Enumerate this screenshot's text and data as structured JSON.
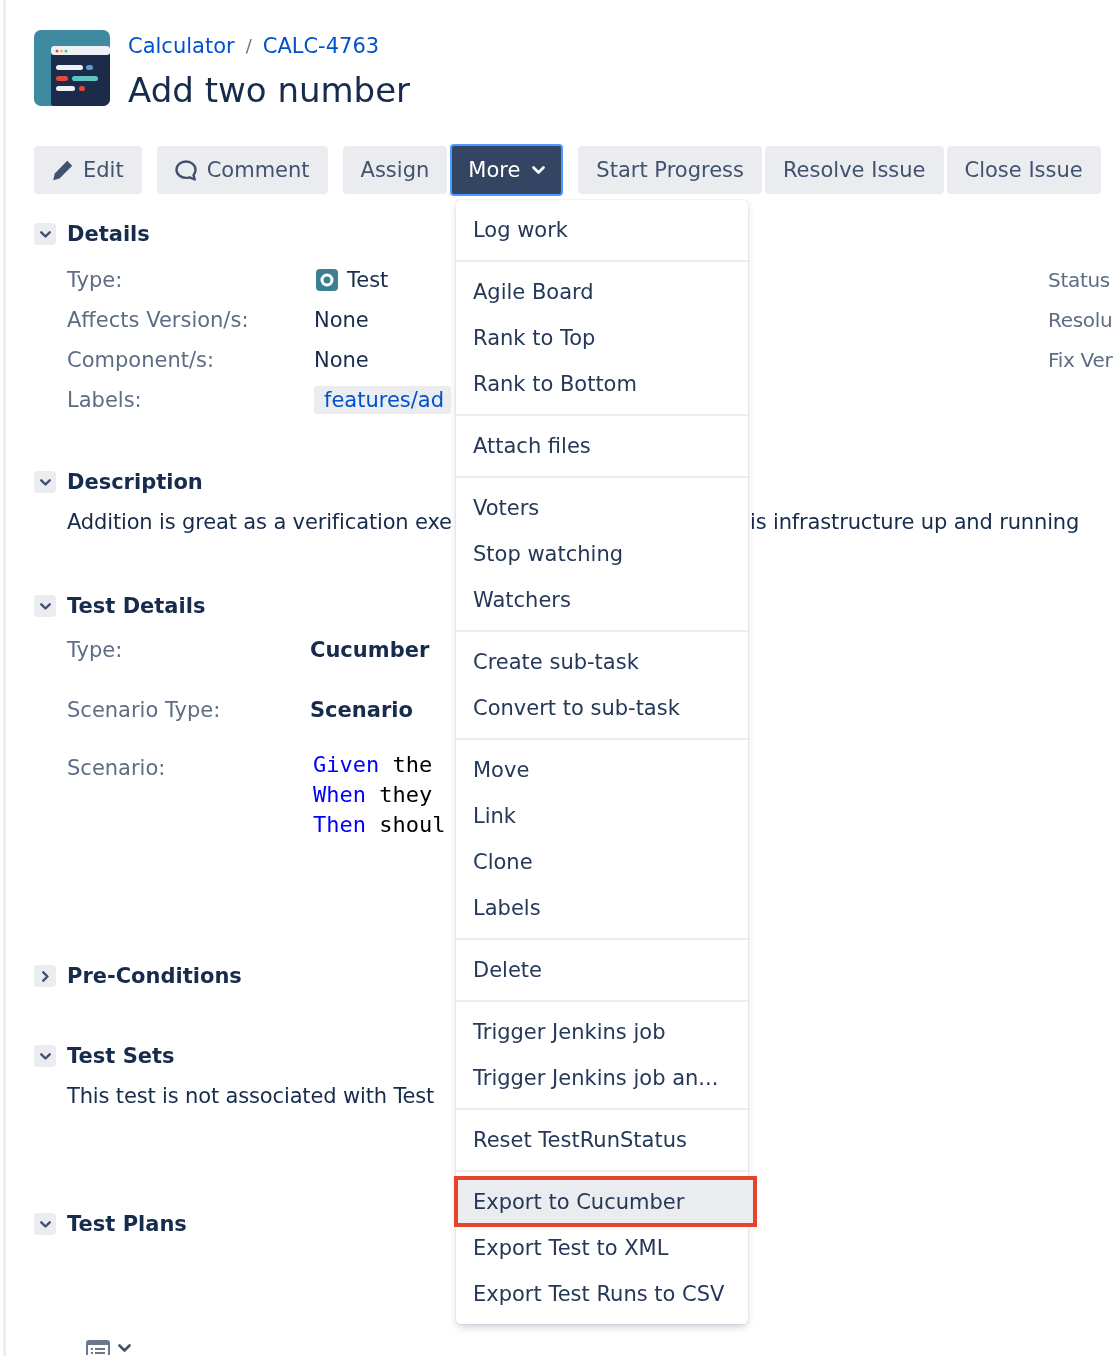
{
  "breadcrumb": {
    "items": [
      "Calculator",
      "CALC-4763"
    ],
    "separator": "/"
  },
  "title": "Add two number",
  "toolbar": {
    "groups": [
      {
        "buttons": [
          {
            "label": "Edit",
            "kind": "edit",
            "expanded": false
          }
        ]
      },
      {
        "buttons": [
          {
            "label": "Comment",
            "kind": "comment",
            "expanded": false
          }
        ]
      },
      {
        "buttons": [
          {
            "label": "Assign",
            "kind": "text",
            "expanded": false
          },
          {
            "label": "More",
            "kind": "dropdown",
            "expanded": true
          }
        ]
      },
      {
        "buttons": [
          {
            "label": "Start Progress",
            "kind": "text",
            "expanded": false
          },
          {
            "label": "Resolve Issue",
            "kind": "text",
            "expanded": false
          },
          {
            "label": "Close Issue",
            "kind": "text",
            "expanded": false
          }
        ]
      }
    ]
  },
  "menu": {
    "groups": [
      {
        "items": [
          {
            "label": "Log work",
            "selected": false,
            "outlined": false
          }
        ]
      },
      {
        "items": [
          {
            "label": "Agile Board",
            "selected": false,
            "outlined": false
          },
          {
            "label": "Rank to Top",
            "selected": false,
            "outlined": false
          },
          {
            "label": "Rank to Bottom",
            "selected": false,
            "outlined": false
          }
        ]
      },
      {
        "items": [
          {
            "label": "Attach files",
            "selected": false,
            "outlined": false
          }
        ]
      },
      {
        "items": [
          {
            "label": "Voters",
            "selected": false,
            "outlined": false
          },
          {
            "label": "Stop watching",
            "selected": false,
            "outlined": false
          },
          {
            "label": "Watchers",
            "selected": false,
            "outlined": false
          }
        ]
      },
      {
        "items": [
          {
            "label": "Create sub-task",
            "selected": false,
            "outlined": false
          },
          {
            "label": "Convert to sub-task",
            "selected": false,
            "outlined": false
          }
        ]
      },
      {
        "items": [
          {
            "label": "Move",
            "selected": false,
            "outlined": false
          },
          {
            "label": "Link",
            "selected": false,
            "outlined": false
          },
          {
            "label": "Clone",
            "selected": false,
            "outlined": false
          },
          {
            "label": "Labels",
            "selected": false,
            "outlined": false
          }
        ]
      },
      {
        "items": [
          {
            "label": "Delete",
            "selected": false,
            "outlined": false
          }
        ]
      },
      {
        "items": [
          {
            "label": "Trigger Jenkins job",
            "selected": false,
            "outlined": false
          },
          {
            "label": "Trigger Jenkins job an...",
            "selected": false,
            "outlined": false
          }
        ]
      },
      {
        "items": [
          {
            "label": "Reset TestRunStatus",
            "selected": false,
            "outlined": false
          }
        ]
      },
      {
        "items": [
          {
            "label": "Export to Cucumber",
            "selected": true,
            "outlined": true
          },
          {
            "label": "Export Test to XML",
            "selected": false,
            "outlined": false
          },
          {
            "label": "Export Test Runs to CSV",
            "selected": false,
            "outlined": false
          }
        ]
      }
    ]
  },
  "sections": [
    {
      "title": "Details",
      "kind": "fields",
      "expanded": true,
      "fields": [
        {
          "label": "Type:",
          "value": "Test",
          "kind": "issue-type"
        },
        {
          "label": "Affects Version/s:",
          "value": "None",
          "kind": "text"
        },
        {
          "label": "Component/s:",
          "value": "None",
          "kind": "text"
        },
        {
          "label": "Labels:",
          "value": "features/ad",
          "kind": "tag"
        }
      ],
      "side_fields": [
        {
          "label": "Status"
        },
        {
          "label": "Resolu"
        },
        {
          "label": "Fix Ver"
        }
      ]
    },
    {
      "title": "Description",
      "kind": "text",
      "expanded": true,
      "text_parts": [
        "Addition is great as a verification exe",
        "is infrastructure up and running"
      ]
    },
    {
      "title": "Test Details",
      "kind": "fields",
      "expanded": true,
      "fields": [
        {
          "label": "Type:",
          "value": "Cucumber",
          "kind": "bold"
        },
        {
          "label": "Scenario Type:",
          "value": "Scenario",
          "kind": "bold"
        },
        {
          "label": "Scenario:",
          "kind": "gherkin",
          "lines": [
            {
              "keyword": "Given",
              "rest": "the"
            },
            {
              "keyword": "When",
              "rest": "they"
            },
            {
              "keyword": "Then",
              "rest": "shoul"
            }
          ]
        }
      ]
    },
    {
      "title": "Pre-Conditions",
      "expanded": false
    },
    {
      "title": "Test Sets",
      "kind": "text",
      "expanded": true,
      "text_parts": [
        "This test is not associated with Test"
      ]
    },
    {
      "title": "Test Plans",
      "kind": "view-menu",
      "expanded": true
    }
  ]
}
